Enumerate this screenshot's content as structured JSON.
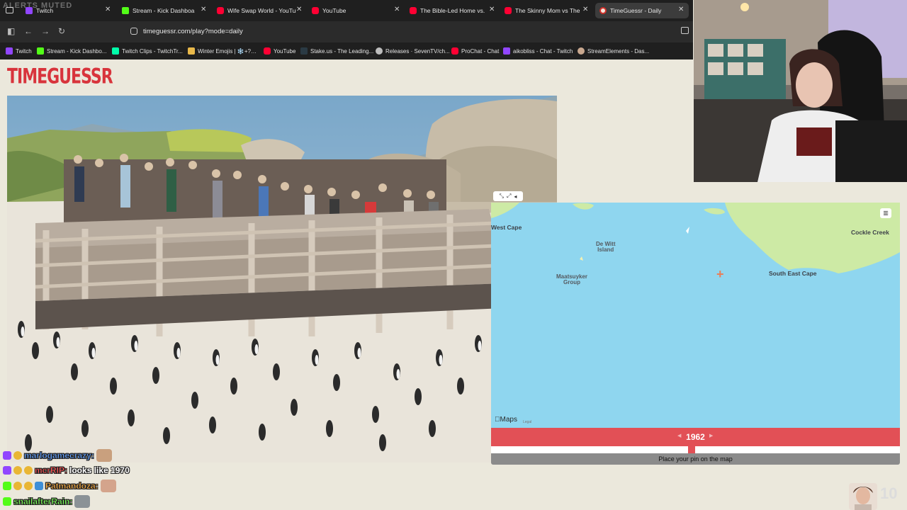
{
  "overlay": {
    "alerts_muted": "ALERTS MUTED"
  },
  "browser": {
    "tabs": [
      {
        "title": "Twitch",
        "favicon": "twitch-icon"
      },
      {
        "title": "Stream - Kick Dashboa",
        "favicon": "kick-icon"
      },
      {
        "title": "Wife Swap World - YouTub",
        "favicon": "youtube-icon"
      },
      {
        "title": "YouTube",
        "favicon": "youtube-icon"
      },
      {
        "title": "The Bible-Led Home vs. Th",
        "favicon": "youtube-icon"
      },
      {
        "title": "The Skinny Mom vs The He",
        "favicon": "youtube-icon"
      },
      {
        "title": "TimeGuessr - Daily",
        "favicon": "timeguessr-icon",
        "active": true
      }
    ],
    "url": "timeguessr.com/play?mode=daily",
    "bookmarks": [
      {
        "label": "Twitch",
        "icon": "twitch-icon"
      },
      {
        "label": "Stream - Kick Dashbo...",
        "icon": "kick-icon"
      },
      {
        "label": "Twitch Clips - TwitchTr...",
        "icon": "clips-icon"
      },
      {
        "label": "Winter Emojis | ❄️+?…",
        "icon": "folder-icon"
      },
      {
        "label": "YouTube",
        "icon": "youtube-icon"
      },
      {
        "label": "Stake.us - The Leading...",
        "icon": "stake-icon"
      },
      {
        "label": "Releases · SevenTV/ch...",
        "icon": "github-icon"
      },
      {
        "label": "ProChat - Chat",
        "icon": "prochat-icon"
      },
      {
        "label": "aikobliss - Chat - Twitch",
        "icon": "twitch-icon"
      },
      {
        "label": "StreamElements - Das...",
        "icon": "streamelements-icon"
      }
    ]
  },
  "game": {
    "logo": "TIMEGUESSR",
    "map": {
      "labels": {
        "west_cape": "West Cape",
        "de_witt": "De Witt\nIsland",
        "maatsuyker": "Maatsuyker\nGroup",
        "south_east_cape": "South East Cape",
        "cockle_creek": "Cockle Creek"
      },
      "attribution": "Maps",
      "legal": "Legal"
    },
    "year": "1962",
    "year_fraction": 0.49,
    "guess_button": "Place your pin on the map"
  },
  "chat": [
    {
      "user": "marlogamecrazy:",
      "color": "#66a3ff",
      "message": ""
    },
    {
      "user": "mcrRIP:",
      "color": "#ff5a5a",
      "message": "looks like 1970"
    },
    {
      "user": "Patmandoza:",
      "color": "#ffb347",
      "message": ""
    },
    {
      "user": "snailafterRain:",
      "color": "#7dff5a",
      "message": ""
    }
  ],
  "stream_overlay": {
    "count": "10"
  },
  "colors": {
    "accent": "#e25056",
    "map_water": "#8fd6ef",
    "map_land": "#cdeaa5"
  }
}
